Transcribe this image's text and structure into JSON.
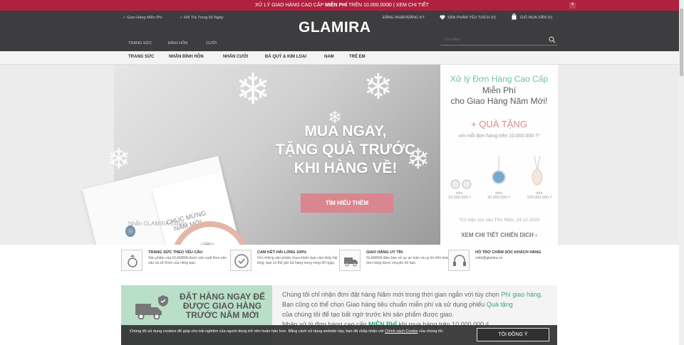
{
  "topbar": {
    "text_pre": "XỬ LÝ GIAO HÀNG CAO CẤP ",
    "text_bold": "MIỄN PHÍ",
    "text_post": " TRÊN 10.000.000Đ | XEM CHI TIẾT",
    "close": "×"
  },
  "header": {
    "left_items": [
      "✓ Giao Hàng Miễn Phí",
      "✓ Đổi Trả Trong 60 Ngày"
    ],
    "login": "ĐĂNG NHẬP/ĐĂNG KÝ",
    "wishlist": "SẢN PHẨM YÊU THÍCH (0)",
    "cart": "GIỎ MUA SẮM (0)",
    "tabs": [
      "TRANG SỨC",
      "ĐÍNH HÔN",
      "CƯỚI"
    ],
    "logo": "GLAMIRA",
    "search_placeholder": "Tìm kiếm"
  },
  "nav": {
    "items": [
      "TRANG SỨC",
      "NHẪN ĐÍNH HÔN",
      "NHẪN CƯỚI",
      "ĐÁ QUÝ & KIM LOẠI",
      "NAM",
      "TRẺ EM"
    ]
  },
  "hero": {
    "title_lines": [
      "MUA NGAY,",
      "TẶNG QUÀ TRƯỚC",
      "KHI HÀNG VỀ!"
    ],
    "button": "TÌM HIỂU THÊM",
    "caption": "Nhẫn GLAMIRA Glinda",
    "card_lines": [
      "CHÚC MỪNG",
      "NĂM MỚI"
    ]
  },
  "promo": {
    "line1": "Xử lý Đơn Hàng Cao Cấp",
    "line2a": "Miễn Phí",
    "line2b": "cho Giao Hàng Năm Mới!",
    "gift": "+ QUÀ TẶNG",
    "sub": "với mỗi đơn hàng trên 10.000.000 ₫*",
    "products": [
      {
        "label": "trên",
        "price": "10.000.000 ₫"
      },
      {
        "label": "trên",
        "price": "30.000.000 ₫"
      },
      {
        "label": "trên",
        "price": "100.000.000 ₫"
      }
    ],
    "note": "*Có hiệu lực vào Thứ Năm, 24.12.2020",
    "detail": "XEM CHI TIẾT CHIẾN DỊCH ›"
  },
  "features": [
    {
      "title": "TRANG SỨC THEO YÊU CẦU",
      "desc": "Sản phẩm của GLAMIRA được sản xuất theo yêu cầu và sở thích của riêng bạn."
    },
    {
      "title": "CAM KẾT HÀI LÒNG 100%",
      "desc": "Với những sản phẩm chưa khiến bạn cảm thấy hài lòng, bạn có thể gửi trả hàng trong vòng 60 ngày."
    },
    {
      "title": "GIAO HÀNG UY TÍN",
      "desc": "GLAMIRA đảm bảo về sự an toàn và uy tín trên từng đơn hàng được chuyển tới bạn."
    },
    {
      "title": "HỖ TRỢ CHĂM SÓC KHÁCH HÀNG",
      "desc": "cskh@glamira.vn"
    }
  ],
  "banner": {
    "left": "ĐẶT HÀNG NGAY ĐỂ ĐƯỢC GIAO HÀNG TRƯỚC NĂM MỚI",
    "p1a": "Chúng tôi chỉ nhận đơn đặt hàng Năm mới trong thời gian ngắn với tùy chọn ",
    "p1b": "Phí giao hàng",
    "p2a": "Bạn cũng có thể chọn Giao hàng tiêu chuẩn miễn phí và sử dụng phiếu ",
    "p2b": "Quà tặng",
    "p3": "của chúng tôi để tạo bất ngờ trước khi sản phẩm được giao.",
    "p4a": "Nhận xử lý đơn hàng cao cấp ",
    "p4b": "MIỄN PHÍ",
    "p4c": " khi mua hàng trên 10.000.000 ₫"
  },
  "cookie": {
    "text": "Chúng tôi sử dụng cookies để giúp cho trải nghiệm của người dùng trở nên hoàn hảo hơn. Bằng cách sử dụng website này, bạn đã chấp nhận với ",
    "link": "Chính sách Cookie",
    "text2": " của chúng tôi.",
    "button": "TÔI ĐỒNG Ý"
  },
  "colors": {
    "accent": "#b0213f",
    "header": "#3d3d3f",
    "mint": "#6bbfa3",
    "pink": "#d9868f"
  }
}
